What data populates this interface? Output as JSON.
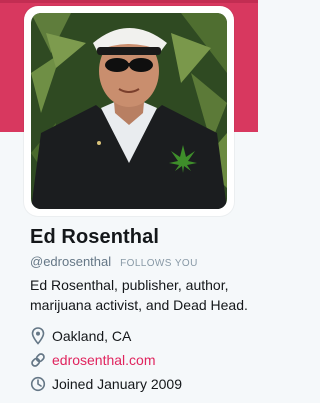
{
  "colors": {
    "banner": "#d8385f",
    "link": "#e0245e",
    "muted": "#657786"
  },
  "profile": {
    "name": "Ed Rosenthal",
    "handle": "@edrosenthal",
    "follows_you": "FOLLOWS YOU",
    "bio": "Ed Rosenthal, publisher, author, marijuana activist, and Dead Head.",
    "location": "Oakland, CA",
    "location_icon": "location-pin-icon",
    "website": "edrosenthal.com",
    "website_icon": "link-icon",
    "joined": "Joined January 2009",
    "joined_icon": "calendar-clock-icon"
  }
}
